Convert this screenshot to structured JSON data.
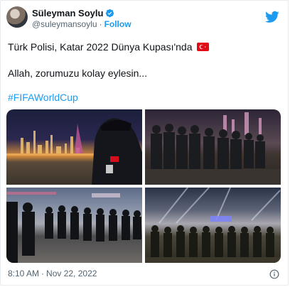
{
  "author": {
    "display_name": "Süleyman Soylu",
    "handle": "@suleymansoylu",
    "separator": "·",
    "follow_label": "Follow"
  },
  "tweet": {
    "line1": "Türk Polisi, Katar 2022 Dünya Kupası'nda",
    "line2": "Allah, zorumuzu kolay eylesin...",
    "hashtag": "#FIFAWorldCup"
  },
  "footer": {
    "time": "8:10 AM",
    "separator": "·",
    "date": "Nov 22, 2022"
  },
  "icons": {
    "verified": "verified-badge-icon",
    "brand": "twitter-bird-icon",
    "flag": "turkey-flag-icon",
    "info": "info-icon"
  },
  "colors": {
    "brand_blue": "#1d9bf0",
    "secondary_text": "#536471",
    "flag_red": "#e30a17"
  }
}
